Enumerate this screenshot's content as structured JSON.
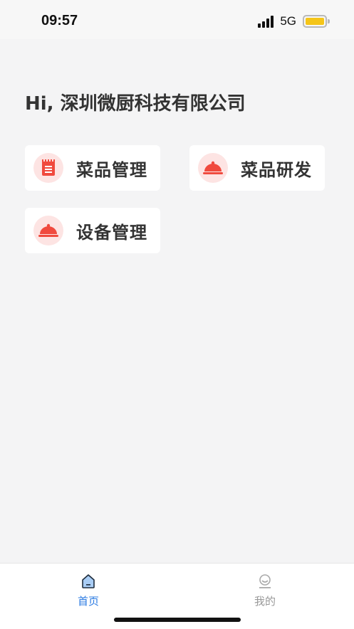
{
  "status_bar": {
    "time": "09:57",
    "network": "5G",
    "battery_color": "#f5c518"
  },
  "greeting": "Hi, 深圳微厨科技有限公司",
  "cards": [
    {
      "label": "菜品管理",
      "icon": "menu-list-icon"
    },
    {
      "label": "菜品研发",
      "icon": "food-cloche-icon"
    },
    {
      "label": "设备管理",
      "icon": "food-cloche-icon"
    }
  ],
  "tabbar": {
    "tabs": [
      {
        "label": "首页",
        "icon": "home-icon",
        "active": true
      },
      {
        "label": "我的",
        "icon": "profile-icon",
        "active": false
      }
    ]
  },
  "colors": {
    "accent": "#2a7ae2",
    "icon_red": "#f04a3e",
    "icon_bg": "#fde4e3"
  }
}
